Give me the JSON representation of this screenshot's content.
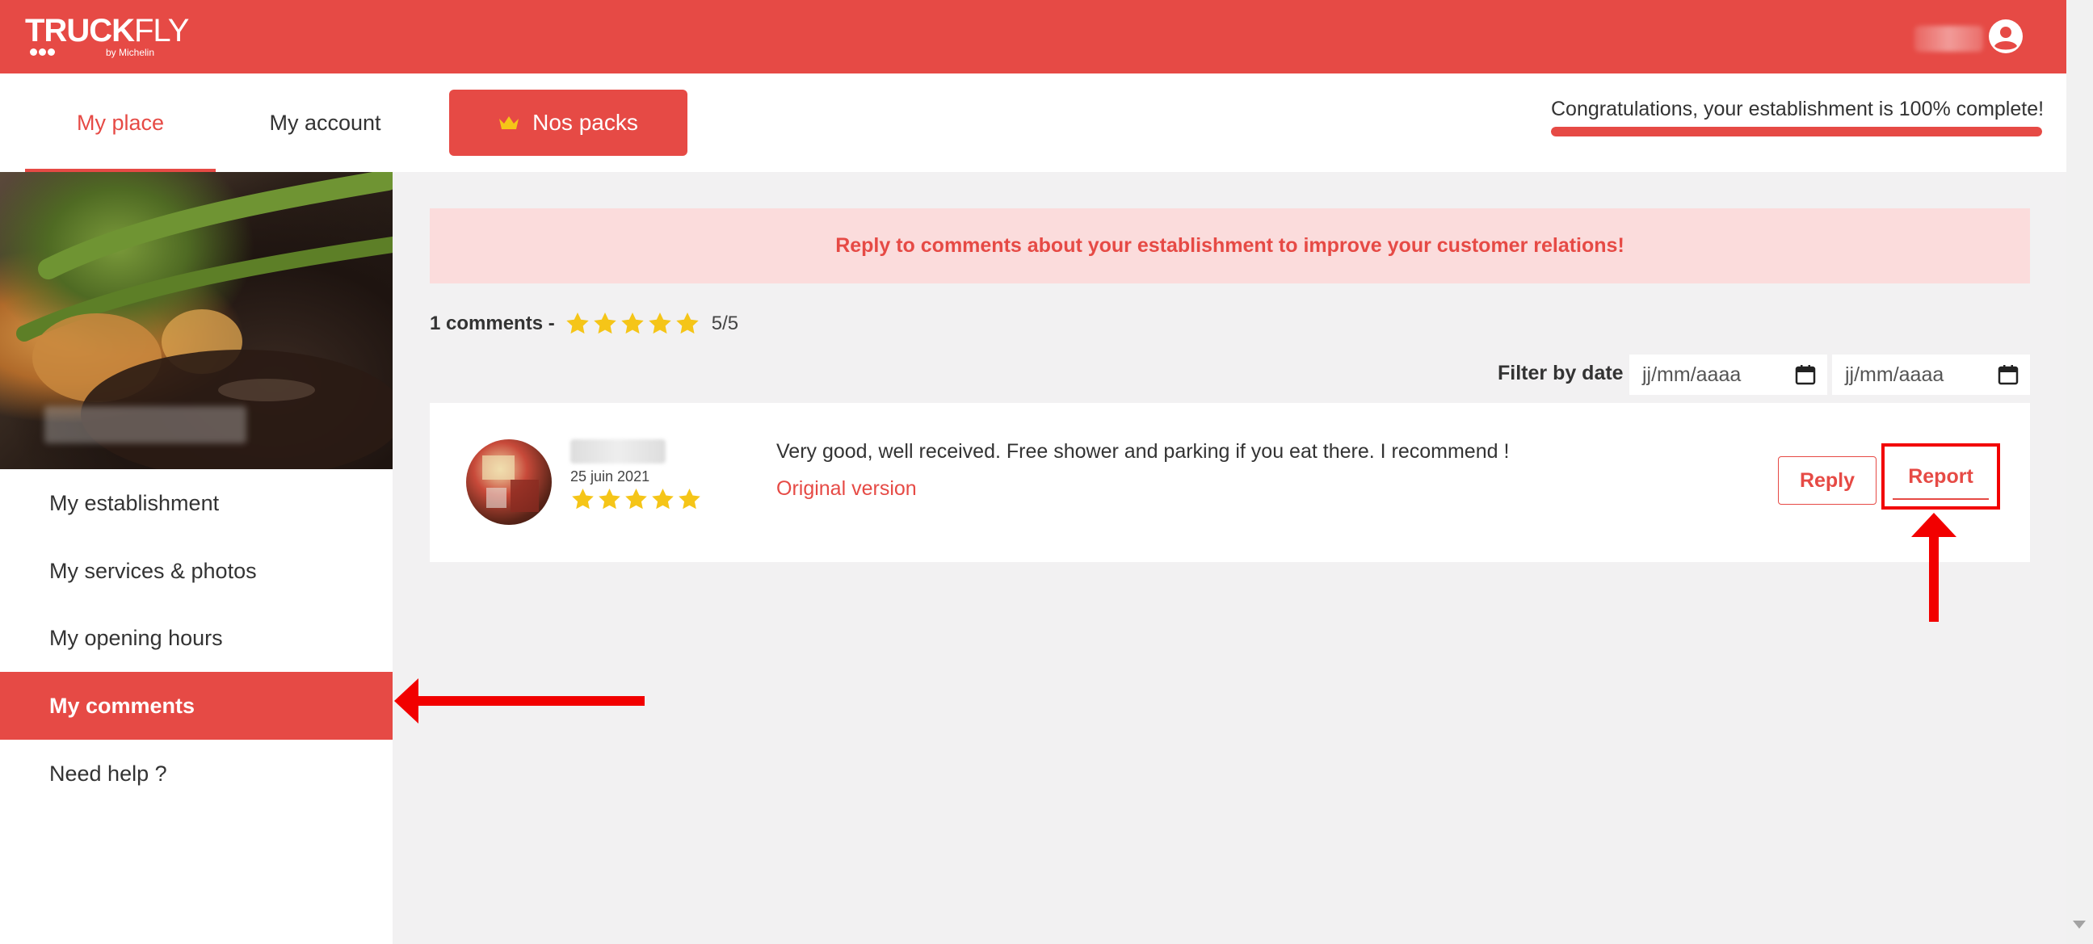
{
  "header": {
    "logo_main": "TRUCK",
    "logo_accent": "FLY",
    "logo_sub": "by Michelin"
  },
  "nav": {
    "tabs": [
      {
        "label": "My place",
        "active": true
      },
      {
        "label": "My account",
        "active": false
      }
    ],
    "packs_label": "Nos packs",
    "progress_text": "Congratulations, your establishment is 100% complete!",
    "progress_value": 1.0
  },
  "sidebar": {
    "items": [
      {
        "label": "My establishment",
        "active": false
      },
      {
        "label": "My services & photos",
        "active": false
      },
      {
        "label": "My opening hours",
        "active": false
      },
      {
        "label": "My comments",
        "active": true
      },
      {
        "label": "Need help ?",
        "active": false
      }
    ]
  },
  "main": {
    "banner": "Reply to comments about your establishment to improve your customer relations!",
    "comments_count": "1 comments -",
    "rating": 5,
    "rating_text": "5/5",
    "filter_label": "Filter by date :",
    "date_from_placeholder": "jj/mm/aaaa",
    "date_to_placeholder": "jj/mm/aaaa"
  },
  "comment": {
    "date": "25 juin 2021",
    "rating": 5,
    "text": "Very good, well received. Free shower and parking if you eat there. I recommend !",
    "original_link": "Original version",
    "reply_label": "Reply",
    "report_label": "Report"
  },
  "colors": {
    "brand": "#e64a45",
    "banner_bg": "#fbdcdc",
    "annotation": "#f20000",
    "star": "#f5c518"
  }
}
